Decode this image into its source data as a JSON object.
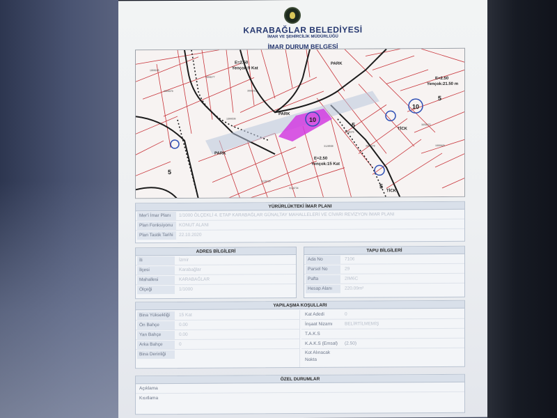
{
  "header": {
    "institution": "KARABAĞLAR BELEDİYESİ",
    "department": "İMAR VE ŞEHİRCİLİK MÜDÜRLÜĞÜ",
    "document_title": "İMAR DURUM BELGESİ"
  },
  "map": {
    "labels": [
      "PARK",
      "PARK",
      "PARK",
      "E=2.50",
      "Yençok:9 Kat",
      "E=2.50",
      "Yençok:15 Kat",
      "E=2.50",
      "Yençok:21.50 m",
      "TİCK",
      "TİCK",
      "10",
      "10",
      "5",
      "5",
      "5",
      "5"
    ],
    "highlight_color": "#d23ce0",
    "line_color": "#c8343a"
  },
  "plan": {
    "heading": "YÜRÜRLÜKTEKİ İMAR PLANI",
    "rows": [
      {
        "label": "Mer'i İmar Planı",
        "value": "1/1000 ÖLÇEKLİ 4. ETAP KARABAĞLAR GÜNALTAY MAHALLELERİ VE CİVARI REVİZYON İMAR PLANI"
      },
      {
        "label": "Plan Fonksiyonu",
        "value": "KONUT ALANI"
      },
      {
        "label": "Plan Tastik Tarihi",
        "value": "22.10.2020"
      }
    ]
  },
  "address": {
    "heading": "ADRES BİLGİLERİ",
    "rows": [
      {
        "label": "İli",
        "value": "İzmir"
      },
      {
        "label": "İlçesi",
        "value": "Karabağlar"
      },
      {
        "label": "Mahallesi",
        "value": "KARABAĞLAR"
      },
      {
        "label": "Ölçeği",
        "value": "1/1000"
      }
    ]
  },
  "deed": {
    "heading": "TAPU BİLGİLERİ",
    "rows": [
      {
        "label": "Ada No",
        "value": "7106"
      },
      {
        "label": "Parsel No",
        "value": "29"
      },
      {
        "label": "Pafta",
        "value": "2IM6C"
      },
      {
        "label": "Hesap Alanı",
        "value": "220.09m²"
      }
    ]
  },
  "conditions": {
    "heading": "YAPILAŞMA KOŞULLARI",
    "left": [
      {
        "label": "Bina Yüksekliği",
        "value": "15 Kat"
      },
      {
        "label": "Ön Bahçe",
        "value": "0.00"
      },
      {
        "label": "Yan Bahçe",
        "value": "0.00"
      },
      {
        "label": "Arka Bahçe",
        "value": "0"
      },
      {
        "label": "Bina Derinliği",
        "value": ""
      }
    ],
    "right": [
      {
        "label": "Kat Adedi",
        "value": "0"
      },
      {
        "label": "İnşaat Nizamı",
        "value": "BELİRTİLMEMİŞ"
      },
      {
        "label": "T.A.K.S",
        "value": ""
      },
      {
        "label": "K.A.K.S (Emsal)",
        "value": "(2.50)"
      },
      {
        "label": "Kot Alınacak Nokta",
        "value": ""
      }
    ]
  },
  "special": {
    "heading": "ÖZEL DURUMLAR",
    "rows": [
      {
        "label": "Açıklama",
        "value": ""
      },
      {
        "label": "Kısıtlama",
        "value": ""
      }
    ]
  }
}
